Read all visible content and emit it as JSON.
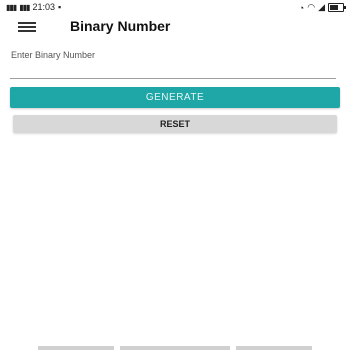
{
  "status_bar": {
    "signal_text": "⋯⋯",
    "time": "21:03",
    "right_text": "✆ ••"
  },
  "app_bar": {
    "title": "Binary Number"
  },
  "form": {
    "input_label": "Enter Binary Number",
    "input_value": ""
  },
  "buttons": {
    "generate_label": "GENERATE",
    "reset_label": "RESET"
  },
  "colors": {
    "accent": "#1fa6a6",
    "reset_bg": "#d8d8d8"
  }
}
